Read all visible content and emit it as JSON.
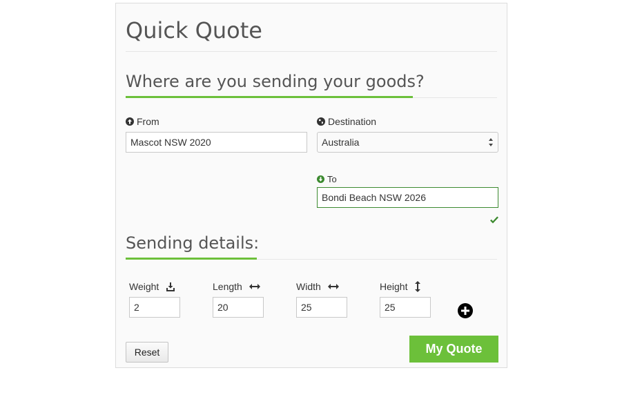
{
  "title": "Quick Quote",
  "section1": {
    "heading": "Where are you sending your goods?"
  },
  "from": {
    "label": "From",
    "value": "Mascot NSW 2020"
  },
  "destination": {
    "label": "Destination",
    "value": "Australia"
  },
  "to": {
    "label": "To",
    "value": "Bondi Beach NSW 2026"
  },
  "section2": {
    "heading": "Sending details:"
  },
  "dimensions": [
    {
      "label": "Weight",
      "value": "2"
    },
    {
      "label": "Length",
      "value": "20"
    },
    {
      "label": "Width",
      "value": "25"
    },
    {
      "label": "Height",
      "value": "25"
    }
  ],
  "buttons": {
    "reset": "Reset",
    "quote": "My Quote"
  },
  "colors": {
    "accent": "#6cc03a",
    "valid_border": "#3c8a2f"
  },
  "icons": {
    "from": "arrow-up-circle-icon",
    "destination": "globe-icon",
    "to": "arrow-down-circle-icon",
    "weight": "download-icon",
    "length": "horizontal-arrows-icon",
    "width": "horizontal-arrows-icon",
    "height": "vertical-arrows-icon",
    "valid": "check-icon",
    "add": "plus-circle-icon"
  }
}
